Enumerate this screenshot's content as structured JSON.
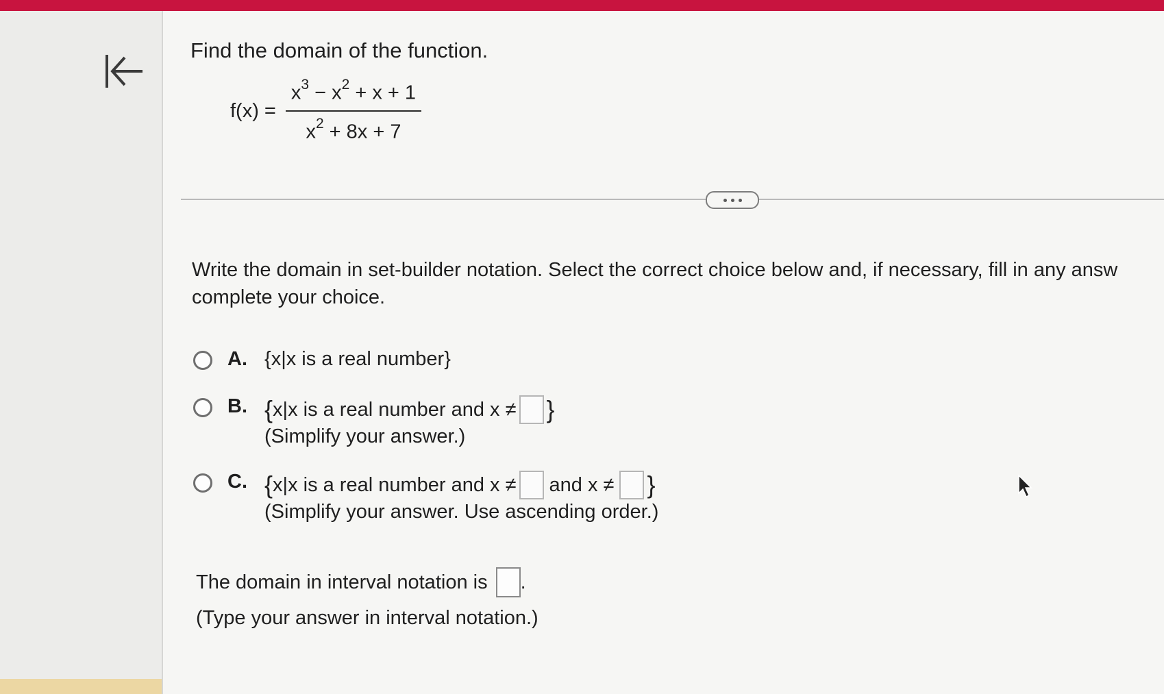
{
  "colors": {
    "top_bar": "#c8143f",
    "sidebar": "#ececea",
    "main_bg": "#f6f6f4"
  },
  "sidebar": {
    "collapse_icon": "collapse-left-arrow-icon"
  },
  "question": {
    "title": "Find the domain of the function.",
    "function_label": "f(x) =",
    "numerator": {
      "t1": "x",
      "e1": "3",
      "t2": " − x",
      "e2": "2",
      "t3": " + x + 1"
    },
    "denominator": {
      "t1": "x",
      "e1": "2",
      "t2": " + 8x + 7"
    }
  },
  "more_button": {
    "icon": "ellipsis-icon"
  },
  "instruction": {
    "line1": "Write the domain in set-builder notation. Select the correct choice below and, if necessary, fill in any answ",
    "line2": "complete your choice."
  },
  "choices": [
    {
      "letter": "A.",
      "open": "{",
      "text": "x|x is a real number",
      "close": "}"
    },
    {
      "letter": "B.",
      "open": "{",
      "text": "x|x is a real number and x ≠",
      "close": "}",
      "note": "(Simplify your answer.)"
    },
    {
      "letter": "C.",
      "open": "{",
      "text": "x|x is a real number and x ≠",
      "middle": "and x ≠",
      "close": "}",
      "note": "(Simplify your answer. Use ascending order.)"
    }
  ],
  "interval": {
    "text": "The domain in interval notation is",
    "period": ".",
    "note": "(Type your answer in interval notation.)"
  },
  "cursor": {
    "icon": "mouse-pointer-icon"
  }
}
